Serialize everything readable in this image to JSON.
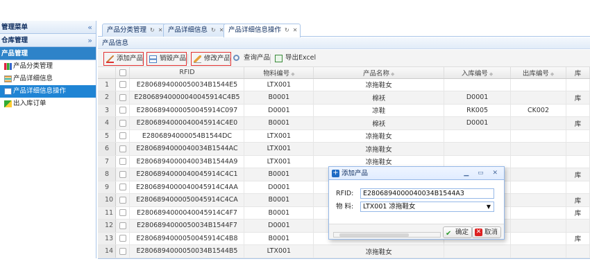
{
  "sidebar": {
    "title": "管理菜单",
    "collapse_icon": "double-chevron-left-icon",
    "groups": [
      {
        "label": "仓库管理",
        "state_icon": "double-chevron-down-icon"
      },
      {
        "label": "产品管理"
      }
    ],
    "items": [
      {
        "label": "产品分类管理",
        "icon": "grid-icon"
      },
      {
        "label": "产品详细信息",
        "icon": "table-icon"
      },
      {
        "label": "产品详细信息操作",
        "icon": "document-icon",
        "selected": true
      },
      {
        "label": "出入库订单",
        "icon": "inout-icon"
      }
    ]
  },
  "tabs": [
    {
      "label": "产品分类管理",
      "refresh": "↻",
      "close": "✕"
    },
    {
      "label": "产品详细信息",
      "refresh": "↻",
      "close": "✕"
    },
    {
      "label": "产品详细信息操作",
      "refresh": "↻",
      "close": "✕",
      "active": true
    }
  ],
  "panel": {
    "title": "产品信息"
  },
  "toolbar": {
    "add": "添加产品",
    "destroy": "销毁产品",
    "edit": "修改产品",
    "query": "查询产品",
    "export": "导出Excel"
  },
  "grid": {
    "columns": [
      "RFID",
      "物料编号",
      "产品名称",
      "入库编号",
      "出库编号",
      "库"
    ],
    "rows": [
      {
        "n": "1",
        "rfid": "E2806894000050034B1544E5",
        "mat": "LTX001",
        "name": "凉拖鞋女",
        "in": "",
        "out": "",
        "st": ""
      },
      {
        "n": "2",
        "rfid": "E28068940000040045914C4B5",
        "mat": "B0001",
        "name": "棉袄",
        "in": "D0001",
        "out": "",
        "st": "库"
      },
      {
        "n": "3",
        "rfid": "E2806894000050045914C097",
        "mat": "D0001",
        "name": "凉鞋",
        "in": "RK005",
        "out": "CK002",
        "st": ""
      },
      {
        "n": "4",
        "rfid": "E2806894000040045914C4E0",
        "mat": "B0001",
        "name": "棉袄",
        "in": "D0001",
        "out": "",
        "st": "库"
      },
      {
        "n": "5",
        "rfid": "E2806894000054B1544DC",
        "mat": "LTX001",
        "name": "凉拖鞋女",
        "in": "",
        "out": "",
        "st": ""
      },
      {
        "n": "6",
        "rfid": "E2806894000040034B1544AC",
        "mat": "LTX001",
        "name": "凉拖鞋女",
        "in": "",
        "out": "",
        "st": ""
      },
      {
        "n": "7",
        "rfid": "E2806894000040034B1544A9",
        "mat": "LTX001",
        "name": "凉拖鞋女",
        "in": "",
        "out": "",
        "st": ""
      },
      {
        "n": "8",
        "rfid": "E2806894000040045914C4C1",
        "mat": "B0001",
        "name": "",
        "in": "",
        "out": "",
        "st": "库"
      },
      {
        "n": "9",
        "rfid": "E2806894000040045914C4AA",
        "mat": "D0001",
        "name": "",
        "in": "",
        "out": "",
        "st": ""
      },
      {
        "n": "10",
        "rfid": "E2806894000050045914C4CA",
        "mat": "B0001",
        "name": "",
        "in": "",
        "out": "",
        "st": "库"
      },
      {
        "n": "11",
        "rfid": "E2806894000040045914C4F7",
        "mat": "B0001",
        "name": "",
        "in": "",
        "out": "",
        "st": "库"
      },
      {
        "n": "12",
        "rfid": "E2806894000050034B1544F7",
        "mat": "D0001",
        "name": "",
        "in": "",
        "out": "",
        "st": ""
      },
      {
        "n": "13",
        "rfid": "E2806894000050045914C4B8",
        "mat": "B0001",
        "name": "",
        "in": "",
        "out": "",
        "st": "库"
      },
      {
        "n": "14",
        "rfid": "E2806894000050034B1544B5",
        "mat": "LTX001",
        "name": "凉拖鞋女",
        "in": "",
        "out": "",
        "st": ""
      }
    ]
  },
  "dialog": {
    "title": "添加产品",
    "title_icon": "plus-icon",
    "tools": "▁ ▭ ✕",
    "rfid_label": "RFID:",
    "rfid_value": "E2806894000040034B1544A3",
    "material_label": "物 料:",
    "material_value": "LTX001 凉拖鞋女",
    "ok": "确定",
    "cancel": "取消"
  }
}
